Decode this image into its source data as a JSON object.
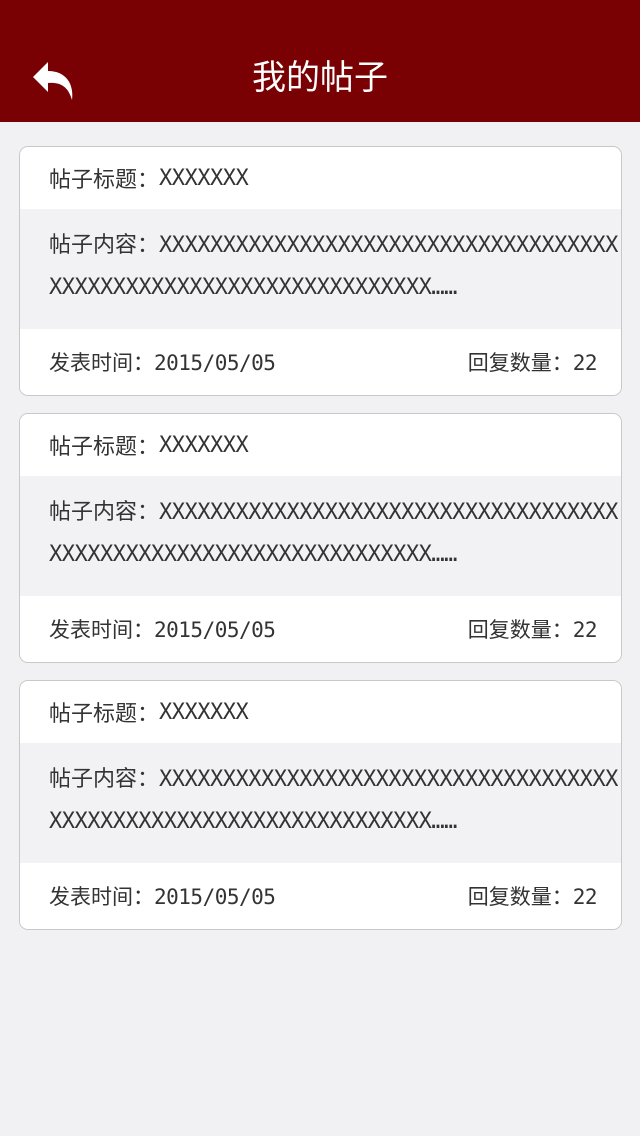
{
  "header": {
    "title": "我的帖子",
    "background": "#790103",
    "back_icon": "back-arrow-icon"
  },
  "posts": [
    {
      "title_label": "帖子标题：",
      "title_value": "XXXXXXX",
      "content_label": "帖子内容：",
      "content_line1": "XXXXXXXXXXXXXXXXXXXXXXXXXXXXXXXXXXXX",
      "content_line2": "XXXXXXXXXXXXXXXXXXXXXXXXXXXXXX……",
      "time_label": "发表时间：",
      "time_value": "2015/05/05",
      "reply_label": "回复数量：",
      "reply_value": "22"
    },
    {
      "title_label": "帖子标题：",
      "title_value": "XXXXXXX",
      "content_label": "帖子内容：",
      "content_line1": "XXXXXXXXXXXXXXXXXXXXXXXXXXXXXXXXXXXX",
      "content_line2": "XXXXXXXXXXXXXXXXXXXXXXXXXXXXXX……",
      "time_label": "发表时间：",
      "time_value": "2015/05/05",
      "reply_label": "回复数量：",
      "reply_value": "22"
    },
    {
      "title_label": "帖子标题：",
      "title_value": "XXXXXXX",
      "content_label": "帖子内容：",
      "content_line1": "XXXXXXXXXXXXXXXXXXXXXXXXXXXXXXXXXXXX",
      "content_line2": "XXXXXXXXXXXXXXXXXXXXXXXXXXXXXX……",
      "time_label": "发表时间：",
      "time_value": "2015/05/05",
      "reply_label": "回复数量：",
      "reply_value": "22"
    }
  ]
}
